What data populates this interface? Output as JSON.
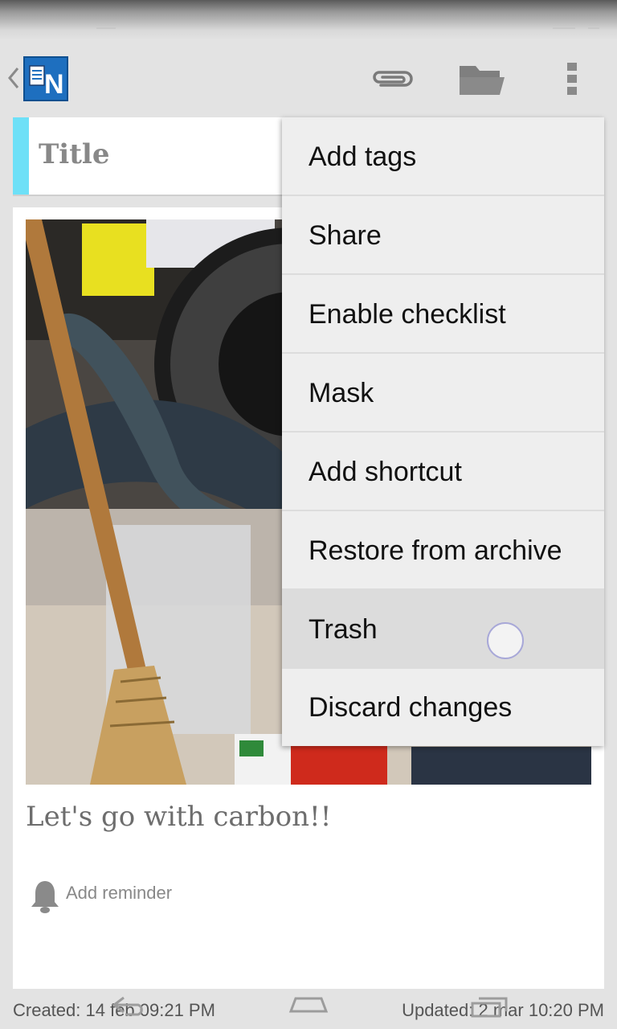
{
  "title_placeholder": "Title",
  "note": {
    "text": "Let's go with carbon!!",
    "reminder_label": "Add reminder"
  },
  "footer": {
    "created": "Created: 14 feb 09:21 PM",
    "updated": "Updated: 2 mar 10:20 PM"
  },
  "actionbar": {
    "icons": [
      "app-logo",
      "attachment-icon",
      "folder-icon",
      "overflow-icon"
    ]
  },
  "menu": {
    "items": [
      {
        "label": "Add tags"
      },
      {
        "label": "Share"
      },
      {
        "label": "Enable checklist"
      },
      {
        "label": "Mask"
      },
      {
        "label": "Add shortcut"
      },
      {
        "label": "Restore from archive"
      },
      {
        "label": "Trash"
      },
      {
        "label": "Discard changes"
      }
    ]
  }
}
